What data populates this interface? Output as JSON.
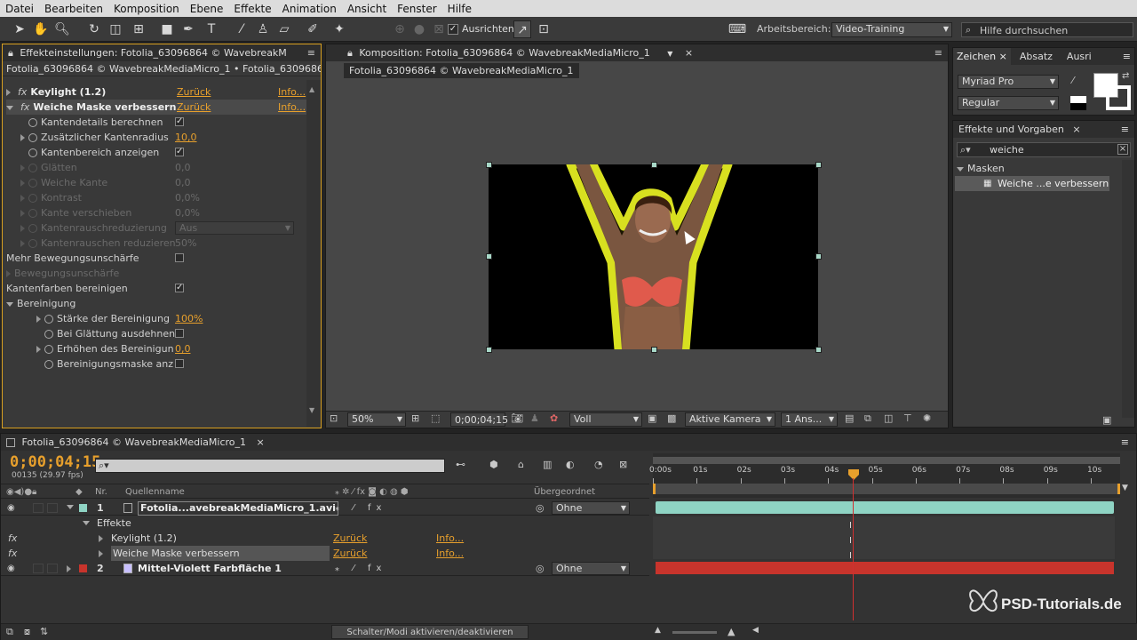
{
  "menu": [
    "Datei",
    "Bearbeiten",
    "Komposition",
    "Ebene",
    "Effekte",
    "Animation",
    "Ansicht",
    "Fenster",
    "Hilfe"
  ],
  "toolbar": {
    "align_label": "Ausrichten",
    "workspace_label": "Arbeitsbereich:",
    "workspace_value": "Video-Training",
    "help_placeholder": "Hilfe durchsuchen"
  },
  "effects_panel": {
    "tab": "Effekteinstellungen: Fotolia_63096864 © WavebreakM",
    "path": "Fotolia_63096864 © WavebreakMediaMicro_1 • Fotolia_63096864 ©",
    "reset": "Zurück",
    "info": "Info...",
    "effects": [
      {
        "name": "Keylight (1.2)"
      },
      {
        "name": "Weiche Maske verbessern"
      }
    ],
    "params": [
      {
        "name": "Kantendetails berechnen",
        "value": "✓",
        "kind": "check",
        "dim": false,
        "tri": false,
        "sw": true,
        "indent": 1
      },
      {
        "name": "Zusätzlicher Kantenradius",
        "value": "10,0",
        "kind": "num",
        "dim": false,
        "tri": true,
        "sw": true,
        "indent": 1
      },
      {
        "name": "Kantenbereich anzeigen",
        "value": "✓",
        "kind": "check",
        "dim": false,
        "tri": false,
        "sw": true,
        "indent": 1
      },
      {
        "name": "Glätten",
        "value": "0,0",
        "kind": "num",
        "dim": true,
        "tri": true,
        "sw": true,
        "indent": 1
      },
      {
        "name": "Weiche Kante",
        "value": "0,0",
        "kind": "num",
        "dim": true,
        "tri": true,
        "sw": true,
        "indent": 1
      },
      {
        "name": "Kontrast",
        "value": "0,0%",
        "kind": "num",
        "dim": true,
        "tri": true,
        "sw": true,
        "indent": 1
      },
      {
        "name": "Kante verschieben",
        "value": "0,0%",
        "kind": "num",
        "dim": true,
        "tri": true,
        "sw": true,
        "indent": 1
      },
      {
        "name": "Kantenrauschreduzierung",
        "value": "Aus",
        "kind": "dropdown",
        "dim": true,
        "tri": true,
        "sw": true,
        "indent": 1
      },
      {
        "name": "Kantenrauschen reduzieren",
        "value": "50%",
        "kind": "num",
        "dim": true,
        "tri": true,
        "sw": true,
        "indent": 1
      },
      {
        "name": "Mehr Bewegungsunschärfe",
        "value": "",
        "kind": "check",
        "dim": false,
        "tri": false,
        "sw": false,
        "indent": 0
      },
      {
        "name": "Bewegungsunschärfe",
        "value": "",
        "kind": "none",
        "dim": true,
        "tri": true,
        "sw": false,
        "indent": 0
      },
      {
        "name": "Kantenfarben bereinigen",
        "value": "✓",
        "kind": "check",
        "dim": false,
        "tri": false,
        "sw": false,
        "indent": 0
      },
      {
        "name": "Bereinigung",
        "value": "",
        "kind": "group",
        "dim": false,
        "tri": true,
        "sw": false,
        "indent": 0
      },
      {
        "name": "Stärke der Bereinigung",
        "value": "100%",
        "kind": "num",
        "dim": false,
        "tri": true,
        "sw": true,
        "indent": 2
      },
      {
        "name": "Bei Glättung ausdehnen",
        "value": "",
        "kind": "check",
        "dim": false,
        "tri": false,
        "sw": true,
        "indent": 2
      },
      {
        "name": "Erhöhen des Bereinigun",
        "value": "0,0",
        "kind": "num",
        "dim": false,
        "tri": true,
        "sw": true,
        "indent": 2
      },
      {
        "name": "Bereinigungsmaske anz",
        "value": "",
        "kind": "check",
        "dim": false,
        "tri": false,
        "sw": true,
        "indent": 2
      }
    ]
  },
  "comp_panel": {
    "tab": "Komposition: Fotolia_63096864 © WavebreakMediaMicro_1",
    "subtab": "Fotolia_63096864 © WavebreakMediaMicro_1",
    "zoom": "50%",
    "timecode": "0;00;04;15",
    "resolution": "Voll",
    "camera": "Aktive Kamera",
    "views": "1 Ans..."
  },
  "char_panel": {
    "tabs": [
      "Zeichen",
      "Absatz",
      "Ausri"
    ],
    "font": "Myriad Pro",
    "style": "Regular"
  },
  "fx_presets": {
    "tab": "Effekte und Vorgaben",
    "search": "weiche",
    "category": "Masken",
    "item": "Weiche ...e verbessern"
  },
  "timeline": {
    "tab": "Fotolia_63096864 © WavebreakMediaMicro_1",
    "timecode": "0;00;04;15",
    "frames": "00135 (29.97 fps)",
    "col_nr": "Nr.",
    "col_source": "Quellenname",
    "col_parent": "Übergeordnet",
    "ticks": [
      "0:00s",
      "01s",
      "02s",
      "03s",
      "04s",
      "05s",
      "06s",
      "07s",
      "08s",
      "09s",
      "10s"
    ],
    "layers": [
      {
        "nr": "1",
        "name": "Fotolia...avebreakMediaMicro_1.avi",
        "parent": "Ohne",
        "color": "#8fd4c4"
      },
      {
        "nr": "2",
        "name": "Mittel-Violett Farbfläche 1",
        "parent": "Ohne",
        "color": "#c8342c"
      }
    ],
    "effects_group": "Effekte",
    "fx_rows": [
      {
        "name": "Keylight (1.2)",
        "reset": "Zurück",
        "info": "Info..."
      },
      {
        "name": "Weiche Maske verbessern",
        "reset": "Zurück",
        "info": "Info..."
      }
    ],
    "toggle_label": "Schalter/Modi aktivieren/deaktivieren"
  },
  "watermark": "PSD-Tutorials.de",
  "colors": {
    "accent": "#e8a02c",
    "selection": "#a8d8c8",
    "matte": "#d8e020",
    "layer2": "#c8342c"
  }
}
